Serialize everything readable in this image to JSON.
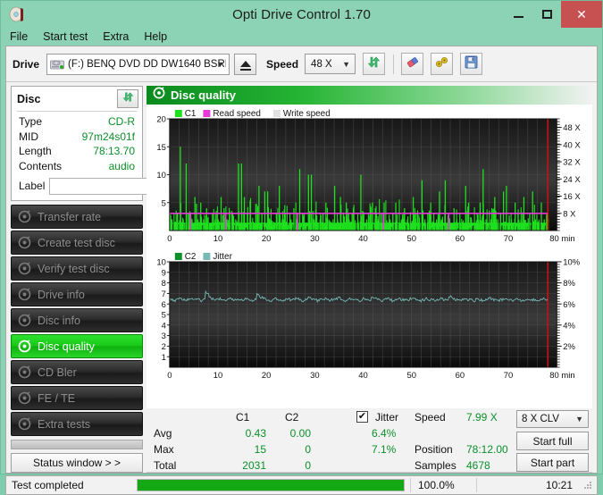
{
  "window": {
    "title": "Opti Drive Control 1.70",
    "icon": "disc-icon",
    "minimize": "–",
    "maximize": "□",
    "close": "✕"
  },
  "menubar": {
    "items": [
      "File",
      "Start test",
      "Extra",
      "Help"
    ]
  },
  "toolbar": {
    "drive_label": "Drive",
    "drive_value": "(F:)   BENQ DVD DD DW1640 BSRB",
    "eject_icon": "eject-icon",
    "speed_label": "Speed",
    "speed_value": "48 X",
    "refresh_icon": "refresh-icon",
    "erase_icon": "eraser-icon",
    "tools_icon": "tools-icon",
    "save_icon": "save-icon"
  },
  "disc": {
    "title": "Disc",
    "refresh_icon": "refresh-icon",
    "rows": [
      {
        "key": "Type",
        "value": "CD-R"
      },
      {
        "key": "MID",
        "value": "97m24s01f"
      },
      {
        "key": "Length",
        "value": "78:13.70"
      },
      {
        "key": "Contents",
        "value": "audio"
      }
    ],
    "label_key": "Label",
    "label_value": "",
    "label_placeholder": "",
    "label_button_icon": "cd-icon"
  },
  "nav": {
    "items": [
      {
        "label": "Transfer rate",
        "icon": "disc-icon",
        "active": false
      },
      {
        "label": "Create test disc",
        "icon": "disc-icon",
        "active": false
      },
      {
        "label": "Verify test disc",
        "icon": "disc-icon",
        "active": false
      },
      {
        "label": "Drive info",
        "icon": "disc-icon",
        "active": false
      },
      {
        "label": "Disc info",
        "icon": "disc-icon",
        "active": false
      },
      {
        "label": "Disc quality",
        "icon": "disc-icon",
        "active": true
      },
      {
        "label": "CD Bler",
        "icon": "disc-icon",
        "active": false
      },
      {
        "label": "FE / TE",
        "icon": "disc-icon",
        "active": false
      },
      {
        "label": "Extra tests",
        "icon": "disc-icon",
        "active": false
      }
    ],
    "status_window": "Status window > >"
  },
  "panel": {
    "header_title": "Disc quality",
    "header_icon": "disc-icon"
  },
  "stats": {
    "col_c1": "C1",
    "col_c2": "C2",
    "jitter_label": "Jitter",
    "jitter_checked": true,
    "rows": [
      {
        "name": "Avg",
        "c1": "0.43",
        "c2": "0.00",
        "jitter": "6.4%"
      },
      {
        "name": "Max",
        "c1": "15",
        "c2": "0",
        "jitter": "7.1%"
      },
      {
        "name": "Total",
        "c1": "2031",
        "c2": "0",
        "jitter": ""
      }
    ],
    "speed_label": "Speed",
    "speed_value": "7.99 X",
    "position_label": "Position",
    "position_value": "78:12.00",
    "samples_label": "Samples",
    "samples_value": "4678",
    "clv_value": "8 X CLV",
    "start_full": "Start full",
    "start_part": "Start part"
  },
  "statusbar": {
    "text": "Test completed",
    "progress": 100.0,
    "progress_text": "100.0%",
    "elapsed": "10:21"
  },
  "colors": {
    "accent_green": "#18c818",
    "value_green": "#0b8f29",
    "c1_green": "#1ee01e",
    "read_speed_magenta": "#e838d8",
    "write_speed_gray": "#e0e0e0",
    "jitter_teal": "#76b8b4",
    "close_red": "#c75050",
    "titlebar": "#8bd3b4",
    "marker_red": "#e00000"
  },
  "chart_data": [
    {
      "type": "line",
      "id": "c1-chart",
      "title": "",
      "xlabel": "min",
      "ylabel": "",
      "xlim": [
        0,
        80
      ],
      "ylim": [
        0,
        20
      ],
      "xticks": [
        0,
        10,
        20,
        30,
        40,
        50,
        60,
        70,
        80
      ],
      "xticklabels": [
        "0",
        "10",
        "20",
        "30",
        "40",
        "50",
        "60",
        "70",
        "80 min"
      ],
      "yticks": [
        5,
        10,
        15,
        20
      ],
      "yticklabels": [
        "5",
        "10",
        "15",
        "20"
      ],
      "y2lim": [
        0,
        52
      ],
      "y2ticks": [
        8,
        16,
        24,
        32,
        40,
        48
      ],
      "y2ticklabels": [
        "8 X",
        "16 X",
        "24 X",
        "32 X",
        "40 X",
        "48 X"
      ],
      "grid": true,
      "legend": [
        {
          "name": "C1",
          "color": "#1ee01e"
        },
        {
          "name": "Read speed",
          "color": "#e838d8"
        },
        {
          "name": "Write speed",
          "color": "#e0e0e0"
        }
      ],
      "legend_position": "top-left",
      "marker_x": 78.2,
      "series": [
        {
          "name": "C1",
          "color": "#1ee01e",
          "type": "impulse",
          "x_start": 0,
          "x_end": 78.2,
          "baseline": 1.4,
          "values": [
            2,
            1,
            3,
            15,
            2,
            12,
            3,
            2,
            6,
            2,
            5,
            2,
            4,
            1,
            3,
            2,
            2,
            6,
            4,
            2,
            1,
            3,
            2,
            12,
            12,
            6,
            3,
            2,
            1,
            2,
            8,
            3,
            7,
            7,
            2,
            1,
            3,
            8,
            2,
            3,
            1,
            2,
            4,
            2,
            11,
            3,
            1,
            10,
            10,
            2,
            1,
            2,
            3,
            5,
            2,
            1,
            8,
            2,
            6,
            3,
            5,
            2,
            3,
            1,
            2,
            10,
            3,
            2,
            1,
            5,
            4,
            2,
            3,
            5,
            1,
            2,
            3,
            5,
            1,
            2,
            4,
            2,
            1,
            6,
            3,
            1,
            9,
            2,
            3,
            5,
            1,
            2,
            7,
            2,
            9,
            2,
            1,
            4,
            2,
            3,
            1,
            8,
            5,
            2,
            1,
            3,
            5,
            11,
            2,
            1,
            4,
            6,
            2,
            3,
            7,
            8,
            2,
            1,
            5,
            3,
            2,
            6,
            1,
            3,
            7,
            2,
            1,
            5,
            2,
            3
          ]
        },
        {
          "name": "Read speed",
          "color": "#e838d8",
          "type": "line",
          "constant_value_x": 7.99,
          "description": "flat magenta line at ~8X on secondary axis"
        }
      ]
    },
    {
      "type": "line",
      "id": "c2-jitter-chart",
      "title": "",
      "xlabel": "min",
      "ylabel": "",
      "xlim": [
        0,
        80
      ],
      "ylim": [
        0,
        10
      ],
      "xticks": [
        0,
        10,
        20,
        30,
        40,
        50,
        60,
        70,
        80
      ],
      "xticklabels": [
        "0",
        "10",
        "20",
        "30",
        "40",
        "50",
        "60",
        "70",
        "80 min"
      ],
      "yticks": [
        1,
        2,
        3,
        4,
        5,
        6,
        7,
        8,
        9,
        10
      ],
      "yticklabels": [
        "1",
        "2",
        "3",
        "4",
        "5",
        "6",
        "7",
        "8",
        "9",
        "10"
      ],
      "y2lim": [
        0,
        10
      ],
      "y2ticks": [
        2,
        4,
        6,
        8,
        10
      ],
      "y2ticklabels": [
        "2%",
        "4%",
        "6%",
        "8%",
        "10%"
      ],
      "grid": true,
      "legend": [
        {
          "name": "C2",
          "color": "#0b8f29"
        },
        {
          "name": "Jitter",
          "color": "#76b8b4"
        }
      ],
      "legend_position": "top-left",
      "marker_x": 78.2,
      "series": [
        {
          "name": "C2",
          "color": "#0b8f29",
          "type": "impulse",
          "values": []
        },
        {
          "name": "Jitter",
          "color": "#76b8b4",
          "type": "line",
          "avg": 6.4,
          "max": 7.1,
          "values": [
            6.4,
            6.3,
            6.4,
            6.5,
            6.4,
            6.3,
            6.4,
            6.5,
            6.4,
            6.4,
            6.3,
            6.5,
            7.1,
            6.6,
            6.5,
            6.4,
            6.5,
            6.4,
            6.3,
            6.4,
            6.5,
            6.4,
            6.4,
            6.3,
            6.4,
            6.5,
            6.4,
            6.3,
            6.4,
            6.9,
            6.6,
            6.5,
            6.4,
            6.3,
            6.4,
            6.5,
            6.4,
            6.3,
            6.4,
            6.5,
            6.4,
            6.4,
            6.5,
            6.4,
            6.3,
            6.4,
            6.6,
            6.5,
            6.4,
            6.3,
            6.4,
            6.5,
            6.4,
            6.3,
            6.4,
            6.5,
            6.6,
            6.4,
            6.3,
            6.4,
            6.5,
            6.4,
            6.4,
            6.3,
            6.5,
            6.4,
            6.4,
            6.6,
            6.5,
            6.4,
            6.3,
            6.4,
            6.5,
            6.4,
            6.3,
            6.4,
            6.5,
            6.4,
            6.4,
            6.3,
            6.5,
            6.6,
            6.4,
            6.3,
            6.4,
            6.5,
            6.4,
            6.4,
            6.3,
            6.4,
            6.5,
            6.4,
            6.3,
            6.7,
            6.5,
            6.4,
            6.3,
            6.4,
            6.5,
            6.4,
            6.4,
            6.3,
            6.5,
            6.4,
            6.3,
            6.4,
            6.6,
            6.5,
            6.4,
            6.3,
            6.4,
            6.5,
            6.4,
            6.4,
            6.3,
            6.5,
            6.4,
            6.3,
            6.4,
            6.5,
            6.4,
            6.4,
            6.3,
            6.4,
            6.5,
            6.4
          ]
        }
      ]
    }
  ]
}
